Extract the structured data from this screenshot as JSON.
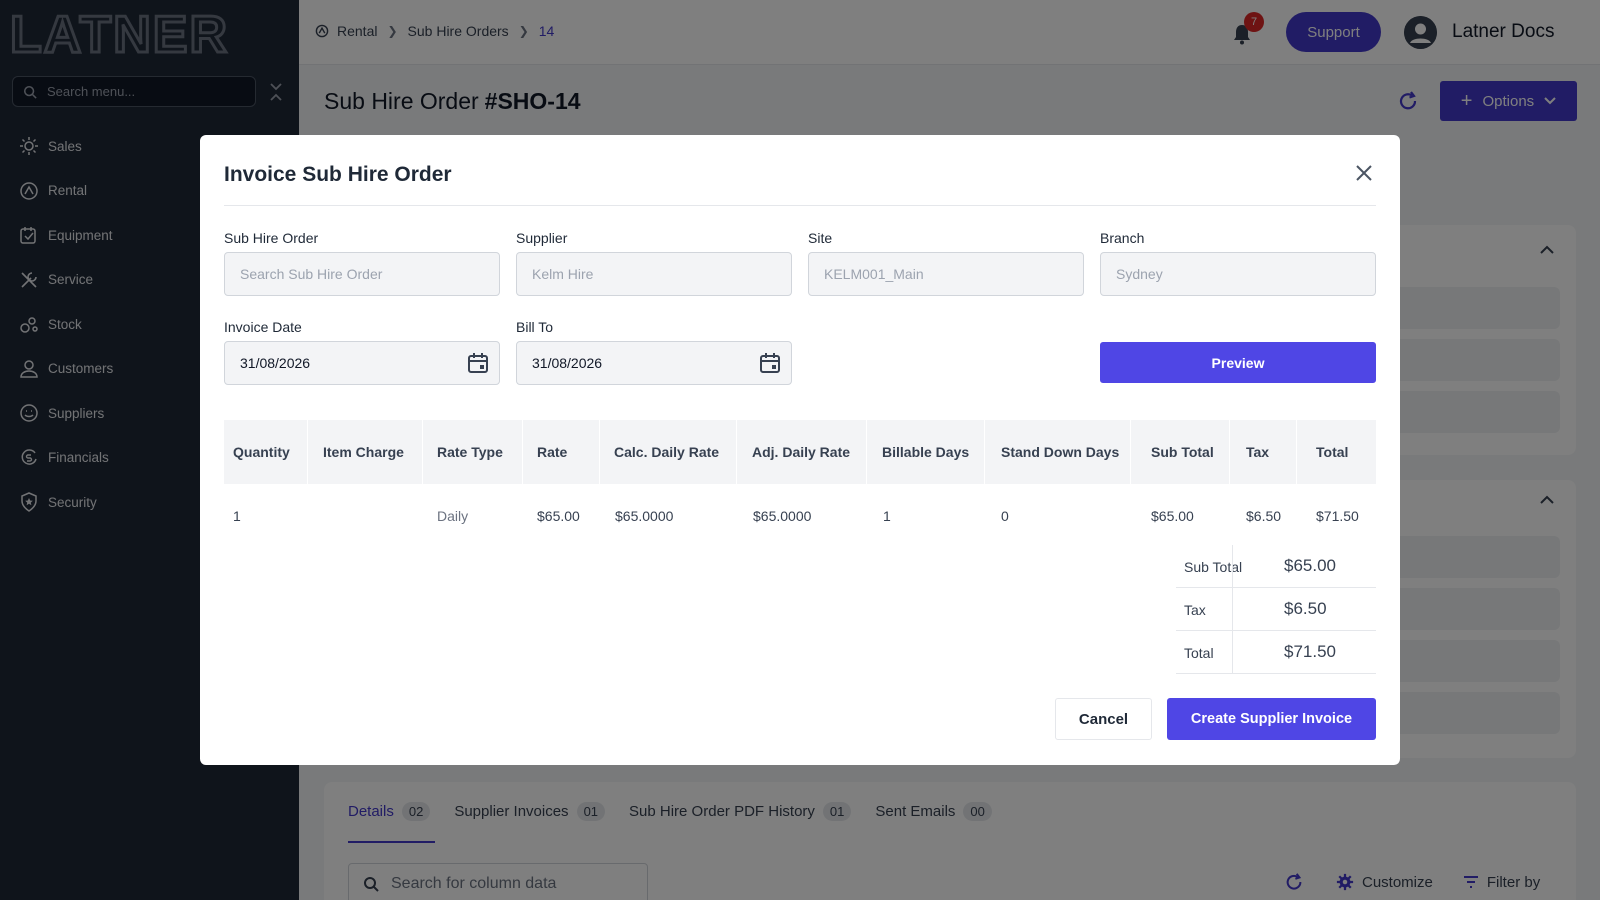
{
  "brand": {
    "logo_text": "LATNER"
  },
  "sidebar": {
    "search_placeholder": "Search menu...",
    "items": [
      {
        "label": "Sales",
        "icon": "sales-icon"
      },
      {
        "label": "Rental",
        "icon": "rental-icon"
      },
      {
        "label": "Equipment",
        "icon": "equipment-icon"
      },
      {
        "label": "Service",
        "icon": "service-icon"
      },
      {
        "label": "Stock",
        "icon": "stock-icon"
      },
      {
        "label": "Customers",
        "icon": "customers-icon"
      },
      {
        "label": "Suppliers",
        "icon": "suppliers-icon"
      },
      {
        "label": "Financials",
        "icon": "financials-icon"
      },
      {
        "label": "Security",
        "icon": "security-icon"
      }
    ]
  },
  "header": {
    "breadcrumb": [
      "Rental",
      "Sub Hire Orders",
      "14"
    ],
    "notification_count": "7",
    "support_label": "Support",
    "user_name": "Latner Docs"
  },
  "page": {
    "title": "Sub Hire Order",
    "order_number": "#SHO-14",
    "options_label": "Options",
    "tabs": [
      {
        "label": "Details",
        "count": "02"
      },
      {
        "label": "Supplier Invoices",
        "count": "01"
      },
      {
        "label": "Sub Hire Order PDF History",
        "count": "01"
      },
      {
        "label": "Sent Emails",
        "count": "00"
      }
    ],
    "column_search_placeholder": "Search for column data",
    "customize_label": "Customize",
    "filter_label": "Filter by"
  },
  "modal": {
    "title": "Invoice Sub Hire Order",
    "fields": {
      "sub_hire_order": {
        "label": "Sub Hire Order",
        "placeholder": "Search Sub Hire Order"
      },
      "supplier": {
        "label": "Supplier",
        "value": "Kelm Hire"
      },
      "site": {
        "label": "Site",
        "value": "KELM001_Main"
      },
      "branch": {
        "label": "Branch",
        "value": "Sydney"
      },
      "invoice_date": {
        "label": "Invoice Date",
        "value": "31/08/2026"
      },
      "bill_to": {
        "label": "Bill To",
        "value": "31/08/2026"
      }
    },
    "preview_label": "Preview",
    "table": {
      "headers": [
        "Quantity",
        "Item Charge",
        "Rate Type",
        "Rate",
        "Calc. Daily Rate",
        "Adj. Daily Rate",
        "Billable Days",
        "Stand Down Days",
        "Sub Total",
        "Tax",
        "Total"
      ],
      "rows": [
        [
          "1",
          "",
          "Daily",
          "$65.00",
          "$65.0000",
          "$65.0000",
          "1",
          "0",
          "$65.00",
          "$6.50",
          "$71.50"
        ]
      ]
    },
    "summary": [
      {
        "label": "Sub Total",
        "value": "$65.00"
      },
      {
        "label": "Tax",
        "value": "$6.50"
      },
      {
        "label": "Total",
        "value": "$71.50"
      }
    ],
    "cancel_label": "Cancel",
    "create_label": "Create Supplier Invoice"
  }
}
